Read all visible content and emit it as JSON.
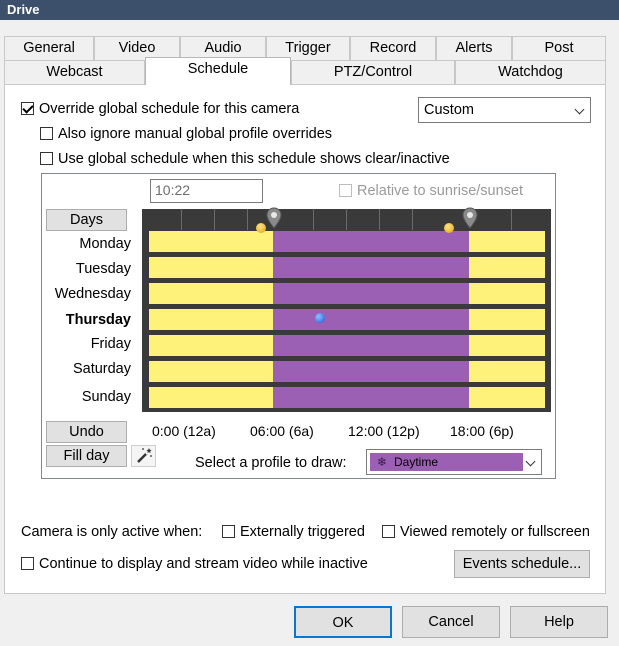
{
  "window": {
    "title": "Drive"
  },
  "tabs_row1": [
    "General",
    "Video",
    "Audio",
    "Trigger",
    "Record",
    "Alerts",
    "Post"
  ],
  "tabs_row2": [
    "Webcast",
    "Schedule",
    "PTZ/Control",
    "Watchdog"
  ],
  "schedule": {
    "override_label": "Override global schedule for this camera",
    "override_checked": true,
    "mode_value": "Custom",
    "ignore_overrides_label": "Also ignore manual global profile overrides",
    "use_global_label": "Use global schedule when this schedule shows clear/inactive",
    "time_value": "10:22",
    "relative_label": "Relative to sunrise/sunset",
    "days_button": "Days",
    "days": [
      "Monday",
      "Tuesday",
      "Wednesday",
      "Thursday",
      "Friday",
      "Saturday",
      "Sunday"
    ],
    "current_day": "Thursday",
    "undo_button": "Undo",
    "fill_day_button": "Fill day",
    "axis_labels": [
      "0:00 (12a)",
      "06:00 (6a)",
      "12:00 (12p)",
      "18:00 (6p)"
    ],
    "profile_prompt": "Select a profile to draw:",
    "profile_value": "Daytime",
    "colors": {
      "daytime": "#9b5fb3",
      "night": "#fff27a",
      "grid": "#3a3a3a"
    }
  },
  "camera_active": {
    "label": "Camera is only active when:",
    "externally_triggered": "Externally triggered",
    "viewed_remotely": "Viewed remotely or fullscreen",
    "continue_label": "Continue to display and stream video while inactive",
    "events_button": "Events schedule..."
  },
  "footer": {
    "ok": "OK",
    "cancel": "Cancel",
    "help": "Help"
  }
}
